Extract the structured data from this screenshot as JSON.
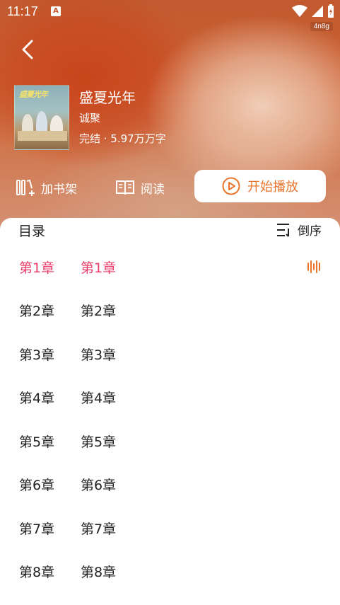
{
  "status_bar": {
    "time": "11:17",
    "notif_icon": "A",
    "network_tag": "4n8g"
  },
  "book": {
    "cover_title": "盛夏光年",
    "title": "盛夏光年",
    "author": "诚聚",
    "meta": "完结 · 5.97万万字"
  },
  "actions": {
    "bookshelf_label": "加书架",
    "read_label": "阅读",
    "play_label": "开始播放"
  },
  "toc": {
    "title": "目录",
    "sort_label": "倒序",
    "chapters": [
      {
        "num": "第1章",
        "name": "第1章"
      },
      {
        "num": "第2章",
        "name": "第2章"
      },
      {
        "num": "第3章",
        "name": "第3章"
      },
      {
        "num": "第4章",
        "name": "第4章"
      },
      {
        "num": "第5章",
        "name": "第5章"
      },
      {
        "num": "第6章",
        "name": "第6章"
      },
      {
        "num": "第7章",
        "name": "第7章"
      },
      {
        "num": "第8章",
        "name": "第8章"
      }
    ],
    "active_index": 0
  },
  "colors": {
    "accent_active": "#ec3d6a",
    "play_orange": "#e8752d"
  }
}
